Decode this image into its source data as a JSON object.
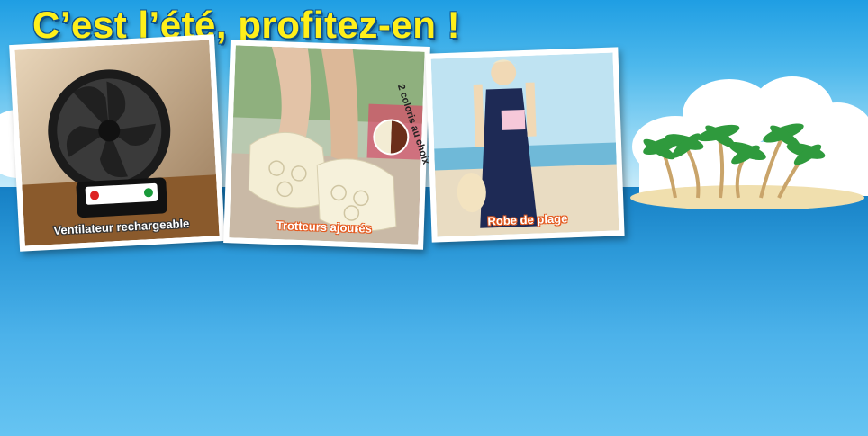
{
  "banner": {
    "headline": "C’est l’été, profitez-en !",
    "colors": {
      "headline": "#ffef1a",
      "sky": "#4db8ec",
      "sea": "#2b98d8",
      "caption_accent": "#e4591e"
    }
  },
  "products": [
    {
      "id": "fan",
      "caption": "Ventilateur rechargeable",
      "icon": "fan-image"
    },
    {
      "id": "shoes",
      "caption": "Trotteurs ajourés",
      "badge": "2 coloris au choix",
      "icon": "shoes-image"
    },
    {
      "id": "dress",
      "caption": "Robe de plage",
      "icon": "dress-image"
    }
  ]
}
